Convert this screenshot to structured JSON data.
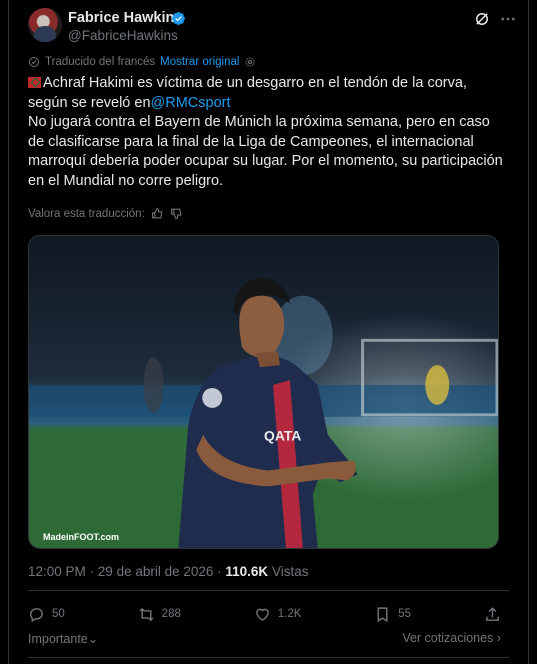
{
  "tweet": {
    "author_name": "Fabrice Hawkins",
    "author_handle": "@FabriceHawkins",
    "verified_badge_icon": "verified-badge-icon",
    "translated_label": "Traducido del francés",
    "show_original": "Mostrar original",
    "body": {
      "line1_text": "Achraf Hakimi es víctima de un desgarro en el tendón de la corva,",
      "line2_text": "según se reveló en",
      "mention": "@RMCsport",
      "paragraph2": "No jugará contra el Bayern de Múnich la próxima semana, pero en caso de clasificarse para la final de la Liga de Campeones, el internacional marroquí debería poder ocupar su lugar. Por el momento, su participación en el Mundial no corre peligro."
    },
    "rate_label": "Valora esta traducción:",
    "media_watermark": "MadeinFOOT.com",
    "time": "12:00 PM",
    "date": "29 de abril de 2026",
    "views_count": "110.6K",
    "views_label": "Vistas",
    "actions": {
      "replies": "50",
      "reposts": "288",
      "likes": "1.2K",
      "bookmarks": "55"
    },
    "footer": {
      "left_label": "Importante",
      "right_label": "Ver cotizaciones"
    }
  },
  "colors": {
    "background": "#000000",
    "text": "#e7e9ea",
    "muted": "#71767b",
    "accent": "#1d9bf0"
  }
}
